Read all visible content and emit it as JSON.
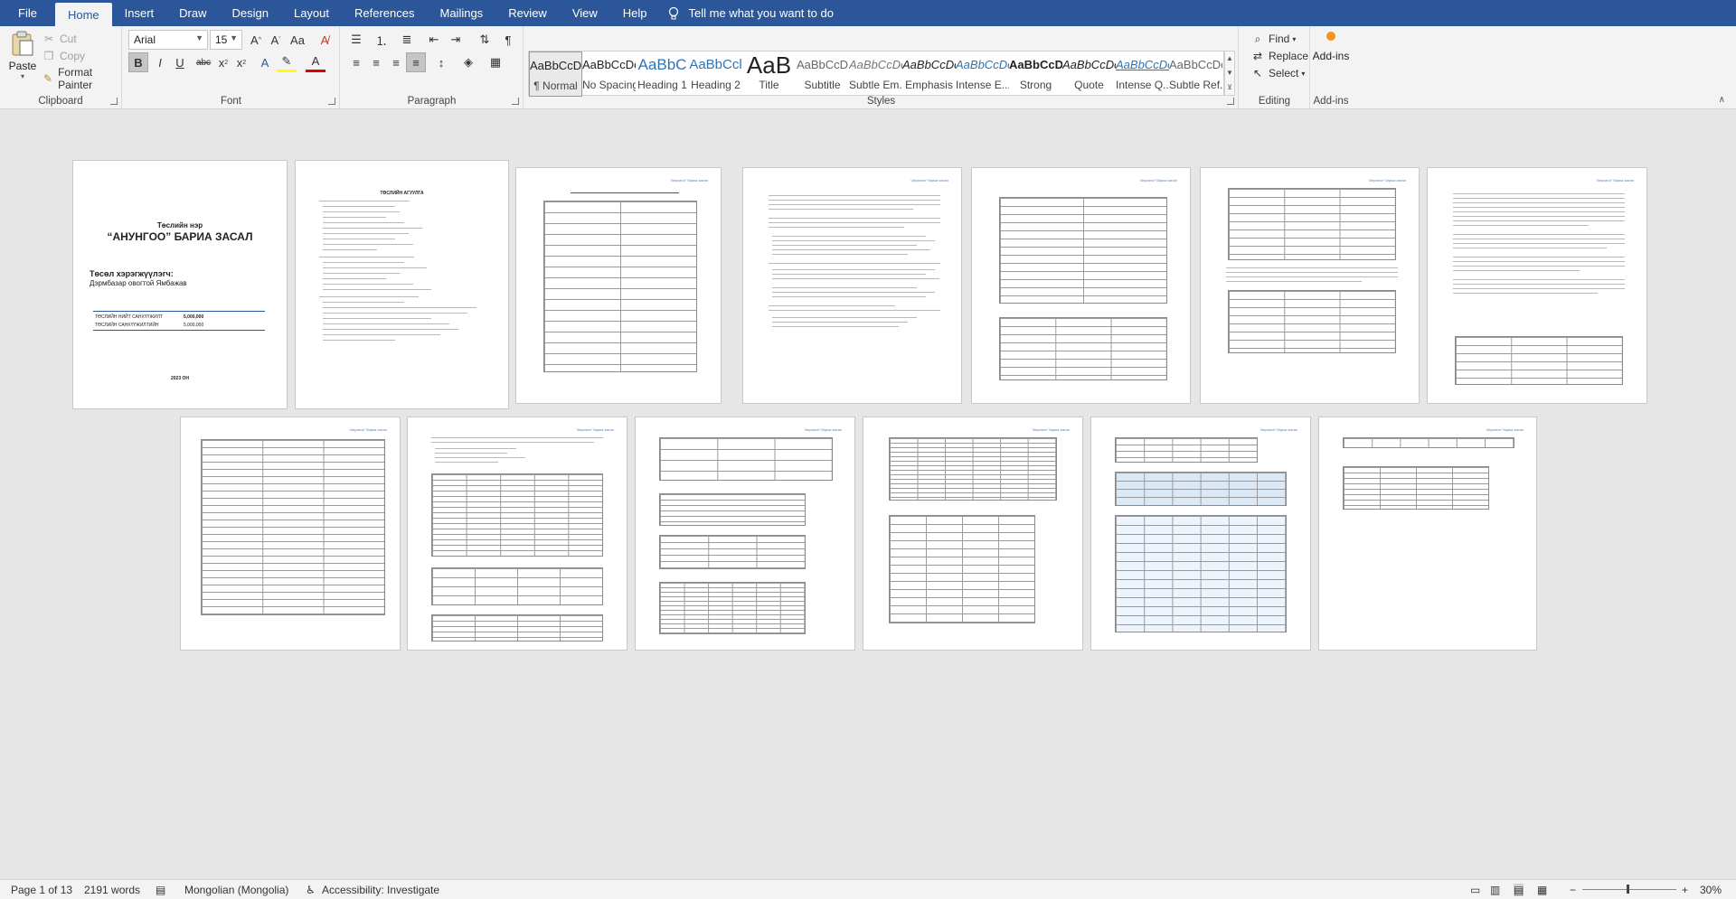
{
  "tabs": [
    "File",
    "Home",
    "Insert",
    "Draw",
    "Design",
    "Layout",
    "References",
    "Mailings",
    "Review",
    "View",
    "Help"
  ],
  "tell_me": "Tell me what you want to do",
  "clipboard": {
    "paste": "Paste",
    "cut": "Cut",
    "copy": "Copy",
    "format_painter": "Format Painter",
    "label": "Clipboard"
  },
  "font": {
    "name": "Arial",
    "size": "15",
    "label": "Font"
  },
  "paragraph": {
    "label": "Paragraph"
  },
  "styles": {
    "label": "Styles",
    "items": [
      {
        "preview": "AaBbCcDc",
        "name": "¶ Normal"
      },
      {
        "preview": "AaBbCcDc",
        "name": "No Spacing"
      },
      {
        "preview": "AaBbC",
        "name": "Heading 1"
      },
      {
        "preview": "AaBbCcl",
        "name": "Heading 2"
      },
      {
        "preview": "AaB",
        "name": "Title"
      },
      {
        "preview": "AaBbCcD",
        "name": "Subtitle"
      },
      {
        "preview": "AaBbCcDc",
        "name": "Subtle Em..."
      },
      {
        "preview": "AaBbCcDc",
        "name": "Emphasis"
      },
      {
        "preview": "AaBbCcDc",
        "name": "Intense E..."
      },
      {
        "preview": "AaBbCcDc",
        "name": "Strong"
      },
      {
        "preview": "AaBbCcDc",
        "name": "Quote"
      },
      {
        "preview": "AaBbCcDc",
        "name": "Intense Q..."
      },
      {
        "preview": "AaBbCcDc",
        "name": "Subtle Ref..."
      }
    ]
  },
  "editing": {
    "find": "Find",
    "replace": "Replace",
    "select": "Select",
    "label": "Editing"
  },
  "addins": {
    "name": "Add-ins",
    "label": "Add-ins"
  },
  "cover": {
    "title1": "Төслийн нэр",
    "title2": "“АНУНГОО” БАРИА ЗАСАЛ",
    "applicant_label": "Төсөл хэрэгжүүлэгч:",
    "applicant": "Дэрмбазар овогтой Ямбажав",
    "row1_label": "ТӨСЛИЙН НИЙТ САНХҮҮЖИЛТ",
    "row1_value": "5,000,000",
    "row2_label": "ТӨСЛИЙН САНХҮҮЖИЛТИЙН",
    "row2_value": "5,000,000",
    "year": "2023 ОН"
  },
  "page_header": "“Анунгоо” бариа засал",
  "toc_title": "ТӨСЛИЙН АГУУЛГА",
  "status": {
    "page": "Page 1 of 13",
    "words": "2191 words",
    "language": "Mongolian (Mongolia)",
    "accessibility": "Accessibility: Investigate",
    "zoom": "30%"
  },
  "colors": {
    "brand": "#2b579a",
    "ribbon": "#f3f3f3",
    "canvas": "#e6e6e6"
  }
}
